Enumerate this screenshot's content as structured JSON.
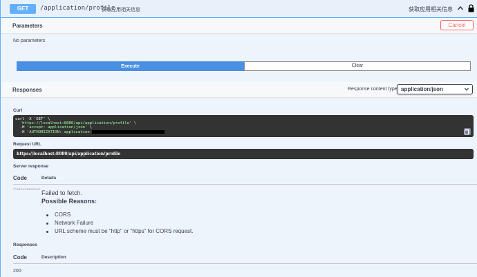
{
  "summary": {
    "method": "GET",
    "path": "/application/profile",
    "description": "获取应用相关信息",
    "right_title": "获取应用相关信息"
  },
  "parameters": {
    "title": "Parameters",
    "cancel_label": "Cancel",
    "empty_text": "No parameters"
  },
  "actions": {
    "execute_label": "Execute",
    "clear_label": "Clear"
  },
  "responses_header": {
    "title": "Responses",
    "content_type_label": "Response content type",
    "content_type_value": "application/json"
  },
  "curl": {
    "label": "Curl",
    "line1": "curl -X 'GET' \\",
    "line2": "'https://localhost:8080/api/application/profile' \\",
    "line3_prefix": "-H ",
    "line3_value": "'accept: application/json'",
    "line3_suffix": " \\",
    "line4_prefix": "-H ",
    "line4_value": "'AUTHORIZATION: application-"
  },
  "request_url": {
    "label": "Request URL",
    "value": "https://localhost:8080/api/application/profile"
  },
  "server_response": {
    "label": "Server response",
    "col_code": "Code",
    "col_details": "Details",
    "status": "Undocumented",
    "error_title": "Failed to fetch.",
    "error_subtitle": "Possible Reasons:",
    "reasons": [
      "CORS",
      "Network Failure",
      "URL scheme must be \"http\" or \"https\" for CORS request."
    ]
  },
  "responses": {
    "label": "Responses",
    "col_code": "Code",
    "col_description": "Description",
    "first_code": "200"
  },
  "colors": {
    "get_accent": "#61affe",
    "execute": "#4990e2",
    "cancel": "#ff6060",
    "code_bg": "#333333"
  }
}
